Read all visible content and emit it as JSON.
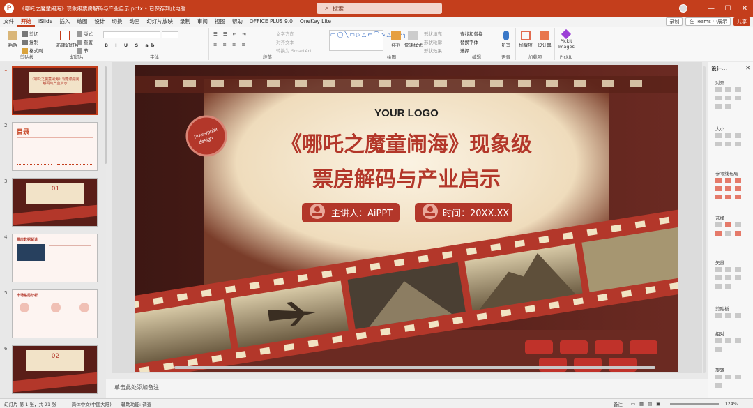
{
  "app": {
    "file_title": "《哪吒之魔童闹海》现象级票房解码与产业启示.pptx • 已保存到此电脑",
    "search_placeholder": "搜索",
    "icon": "P"
  },
  "menu": [
    "文件",
    "开始",
    "iSlide",
    "插入",
    "绘图",
    "设计",
    "切换",
    "动画",
    "幻灯片放映",
    "录制",
    "审阅",
    "视图",
    "帮助",
    "OFFICE PLUS 9.0",
    "OneKey Lite"
  ],
  "menu_right": {
    "record": "录制",
    "teams": "在 Teams 中展示",
    "share": "共享"
  },
  "ribbon": {
    "clipboard": {
      "paste": "粘贴",
      "cut": "剪切",
      "copy": "复制",
      "format": "格式刷",
      "label": "剪贴板"
    },
    "slides": {
      "new": "新建幻灯片",
      "layout": "版式",
      "reset": "重置",
      "section": "节",
      "label": "幻灯片"
    },
    "font": {
      "label": "字体"
    },
    "paragraph": {
      "direction": "文字方向",
      "align": "对齐文本",
      "smartart": "转换为 SmartArt",
      "label": "段落"
    },
    "drawing": {
      "arrange": "排列",
      "quickstyles": "快速样式",
      "fill": "形状填充",
      "outline": "形状轮廓",
      "effects": "形状效果",
      "label": "绘图"
    },
    "editing": {
      "find": "查找和替换",
      "replace": "替换字体",
      "select": "选择",
      "label": "编辑"
    },
    "voice": {
      "dictate": "听写",
      "label": "语音"
    },
    "addins": {
      "addins": "加载项",
      "designer": "设计器",
      "label": "加载项"
    },
    "pickit": {
      "images": "Pickit Images",
      "label": "Pickit"
    }
  },
  "thumbnails": [
    {
      "num": "1",
      "label": "《哪吒之魔童闹海》现象级票房解码与产业启示"
    },
    {
      "num": "2",
      "label": "目录"
    },
    {
      "num": "3",
      "label": "01"
    },
    {
      "num": "4",
      "label": "票房数据解读"
    },
    {
      "num": "5",
      "label": "市场格局分析"
    },
    {
      "num": "6",
      "label": "02"
    }
  ],
  "slide": {
    "logo": "YOUR LOGO",
    "badge_line1": "Powerpoint",
    "badge_line2": "design",
    "title_line1": "《哪吒之魔童闹海》现象级",
    "title_line2": "票房解码与产业启示",
    "presenter": "主讲人：AiPPT",
    "time": "时间：20XX.XX"
  },
  "notes_placeholder": "单击此处添加备注",
  "right_panel": {
    "header": "设计...",
    "sections": [
      "对齐",
      "大小",
      "参考线布局",
      "选择",
      "矢量",
      "剪贴板",
      "组对",
      "旋转"
    ]
  },
  "status": {
    "slide_info": "幻灯片 第 1 张，共 21 张",
    "language": "简体中文(中国大陆)",
    "accessibility": "辅助功能: 调查",
    "notes": "备注",
    "zoom": "124%"
  },
  "colors": {
    "brand": "#c43e1c",
    "slide_red": "#b3372a",
    "cream": "#f6ecd8"
  }
}
